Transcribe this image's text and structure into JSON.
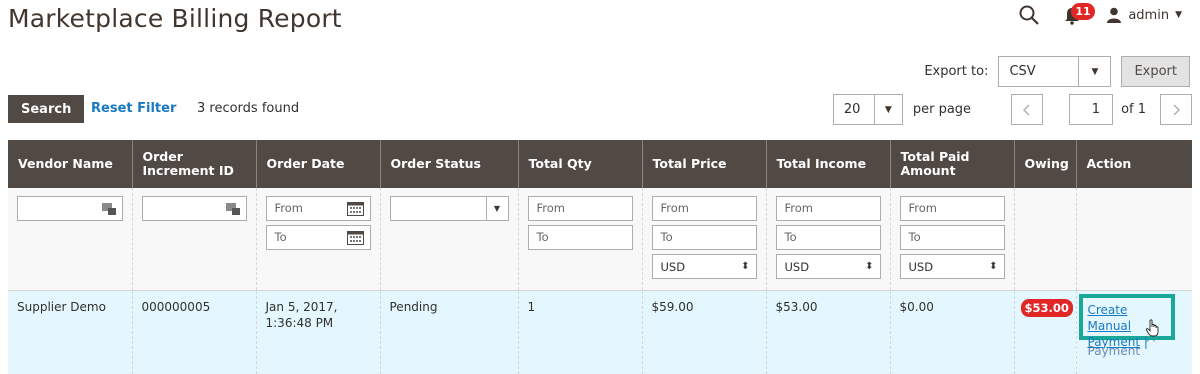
{
  "page": {
    "title": "Marketplace Billing Report"
  },
  "header": {
    "notifications_count": "11",
    "user": "admin"
  },
  "export": {
    "label": "Export to:",
    "format": "CSV",
    "button": "Export"
  },
  "toolbar": {
    "search": "Search",
    "reset": "Reset Filter",
    "records": "3 records found",
    "per_page_value": "20",
    "per_page_label": "per page",
    "page": "1",
    "of_label": "of 1"
  },
  "table": {
    "columns": [
      "Vendor Name",
      "Order Increment ID",
      "Order Date",
      "Order Status",
      "Total Qty",
      "Total Price",
      "Total Income",
      "Total Paid Amount",
      "Owing",
      "Action"
    ],
    "filters": {
      "from": "From",
      "to": "To",
      "currency": "USD"
    },
    "rows": [
      {
        "vendor": "Supplier Demo",
        "increment_id": "000000005",
        "date": "Jan 5, 2017, 1:36:48 PM",
        "status": "Pending",
        "qty": "1",
        "price": "$59.00",
        "income": "$53.00",
        "paid": "$0.00",
        "owing": "$53.00",
        "action_manual": "Create Manual Payment",
        "action_separator": "|",
        "action_paypal": "Create Paypal Payment"
      }
    ]
  },
  "colors": {
    "header_bg": "#514943",
    "link": "#1979c3",
    "badge": "#e22626",
    "highlight": "#1aa89a",
    "row_bg": "#e5f7fe"
  }
}
